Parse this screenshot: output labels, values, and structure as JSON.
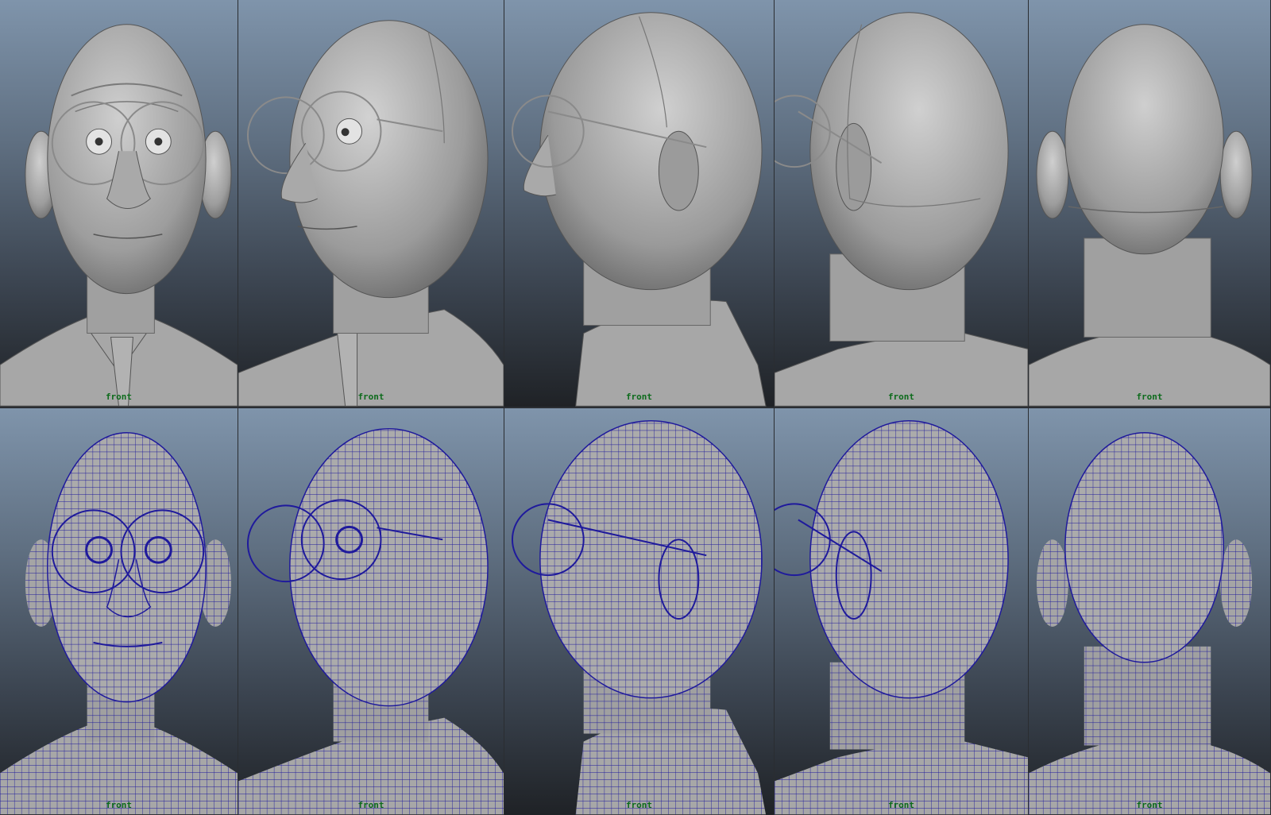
{
  "viewport": {
    "camera_label": "front",
    "camera_label_color": "#0d6b1c",
    "wire_color": "#1f1a9c",
    "mesh_color": "#a9a9a9",
    "background_top": "#7f94ab",
    "background_bottom": "#1f2226"
  },
  "rows": [
    {
      "name": "shaded",
      "panels": [
        {
          "view": "front"
        },
        {
          "view": "three-quarter"
        },
        {
          "view": "profile"
        },
        {
          "view": "back-three-quarter"
        },
        {
          "view": "back"
        }
      ]
    },
    {
      "name": "wireframe-on-shaded",
      "panels": [
        {
          "view": "front"
        },
        {
          "view": "three-quarter"
        },
        {
          "view": "profile"
        },
        {
          "view": "back-three-quarter"
        },
        {
          "view": "back"
        }
      ]
    }
  ]
}
